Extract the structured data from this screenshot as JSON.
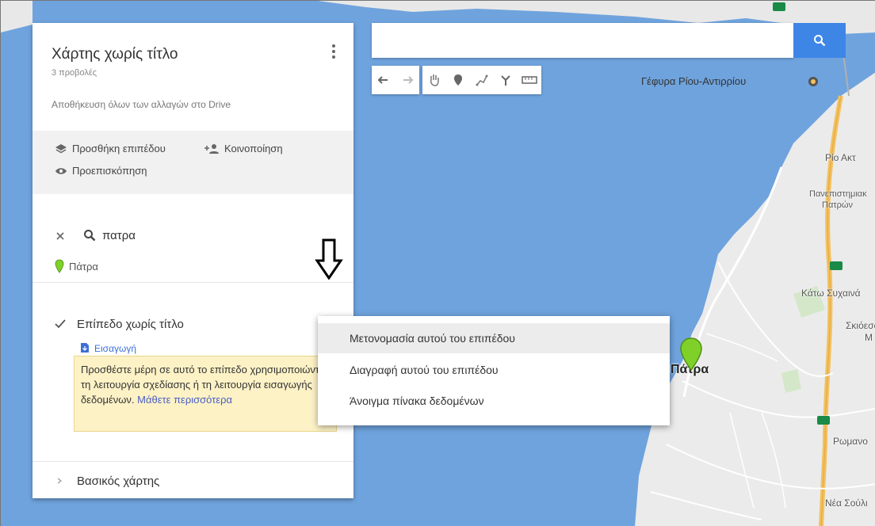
{
  "map": {
    "labels": {
      "bridge": "Γέφυρα Ρίου-Αντιρρίου",
      "rio": "Ρίο  Ακτ",
      "university_1": "Πανεπιστημιακ",
      "university_2": "Πατρών",
      "kato": "Κάτω Συχαινά",
      "skioes_1": "Σκιόεσσα",
      "skioes_2": "Μ",
      "city": "Πάτρα",
      "romano": "Ρωμανο",
      "nea_souli": "Νέα Σούλι"
    },
    "colors": {
      "water": "#6fa3dd",
      "land": "#ececec",
      "road": "#f3c15f",
      "pin": "#7fd12a"
    }
  },
  "search": {
    "placeholder": "",
    "icon": "search-icon"
  },
  "toolbar": {
    "tools": [
      "undo-icon",
      "redo-icon",
      "hand-icon",
      "add-marker-icon",
      "draw-line-icon",
      "directions-icon",
      "measure-icon"
    ]
  },
  "panel": {
    "title": "Χάρτης χωρίς τίτλο",
    "views": "3 προβολές",
    "save_status": "Αποθήκευση όλων των αλλαγών στο Drive",
    "actions": {
      "add_layer": "Προσθήκη επιπέδου",
      "share": "Κοινοποίηση",
      "preview": "Προεπισκόπηση"
    },
    "search_result": {
      "query": "πατρα",
      "place": "Πάτρα"
    },
    "layer": {
      "name": "Επίπεδο χωρίς τίτλο",
      "import": "Εισαγωγή",
      "tooltip_text": "Προσθέστε μέρη σε αυτό το επίπεδο χρησιμοποιώντας τη λειτουργία σχεδίασης ή τη λειτουργία εισαγωγής δεδομένων.",
      "learn_more": "Μάθετε περισσότερα"
    },
    "basemap": "Βασικός χάρτης"
  },
  "context_menu": {
    "items": [
      "Μετονομασία αυτού του επιπέδου",
      "Διαγραφή αυτού του επιπέδου",
      "Άνοιγμα πίνακα δεδομένων"
    ]
  }
}
